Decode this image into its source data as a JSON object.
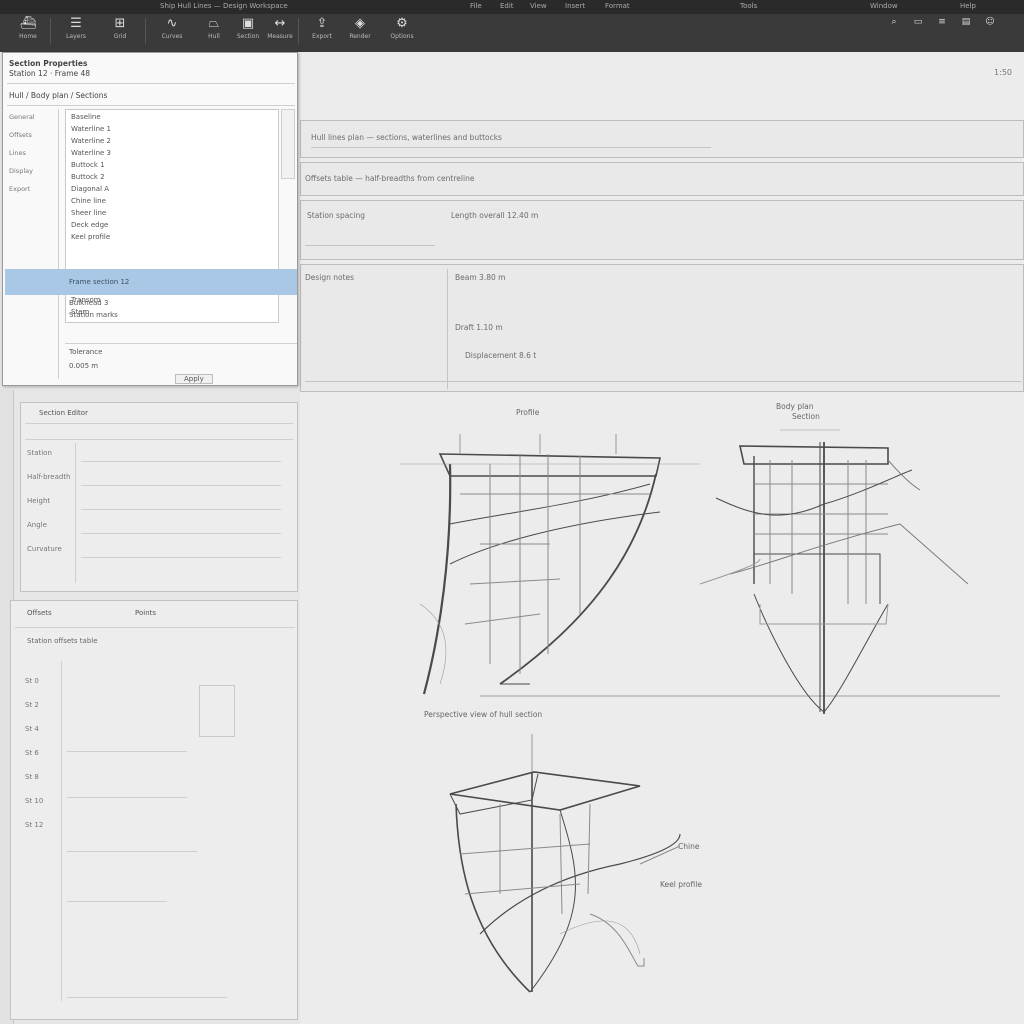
{
  "window": {
    "title": "Ship Hull Lines — Design Workspace",
    "menu": [
      "File",
      "Edit",
      "View",
      "Insert",
      "Format",
      "Tools",
      "Window",
      "Help"
    ]
  },
  "toolbar": {
    "buttons": [
      {
        "icon": "app-logo-icon",
        "glyph": "⛴",
        "label": "Home"
      },
      {
        "icon": "layers-icon",
        "glyph": "☰",
        "label": "Layers"
      },
      {
        "icon": "grid-icon",
        "glyph": "⊞",
        "label": "Grid"
      },
      {
        "icon": "curve-icon",
        "glyph": "∿",
        "label": "Curves"
      },
      {
        "icon": "hull-icon",
        "glyph": "⏢",
        "label": "Hull"
      },
      {
        "icon": "section-icon",
        "glyph": "▣",
        "label": "Section"
      },
      {
        "icon": "measure-icon",
        "glyph": "↔",
        "label": "Measure"
      },
      {
        "icon": "export-icon",
        "glyph": "⇪",
        "label": "Export"
      },
      {
        "icon": "render-icon",
        "glyph": "◈",
        "label": "Render"
      },
      {
        "icon": "settings-icon",
        "glyph": "⚙",
        "label": "Options"
      }
    ],
    "right_icons": [
      "search-icon",
      "window-icon",
      "list-icon",
      "panel-icon",
      "user-icon"
    ]
  },
  "dialog": {
    "title": "Section Properties",
    "subtitle": "Station 12  ·  Frame 48",
    "path_label": "Hull / Body plan / Sections",
    "side_items": [
      "General",
      "Offsets",
      "Lines",
      "Display",
      "Export"
    ],
    "list_items": [
      "Baseline",
      "Waterline 1",
      "Waterline 2",
      "Waterline 3",
      "Buttock 1",
      "Buttock 2",
      "Diagonal A",
      "Chine line",
      "Sheer line",
      "Deck edge",
      "Keel profile"
    ],
    "selected_item": "Frame section 12",
    "lower_items": [
      "Transom",
      "Stem",
      "Bulkhead 3",
      "Station marks"
    ],
    "footer_items": [
      "Tolerance",
      "0.005 m"
    ],
    "footer_button": "Apply"
  },
  "canvas": {
    "tag": "1:50",
    "rows": [
      "Hull lines plan — sections, waterlines and buttocks",
      "Offsets table — half-breadths from centreline",
      "Station spacing",
      "Length overall  12.40 m",
      "Design notes",
      "Beam  3.80 m",
      "Draft  1.10 m",
      "Displacement  8.6 t"
    ]
  },
  "panels": {
    "upper": {
      "title": "Section Editor",
      "rows": [
        "Station",
        "Half-breadth",
        "Height",
        "Angle",
        "Curvature"
      ]
    },
    "lower": {
      "title": "Offsets",
      "secondary": "Points",
      "header": "Station offsets table",
      "rows": [
        "St 0",
        "St 2",
        "St 4",
        "St 6",
        "St 8",
        "St 10",
        "St 12"
      ]
    }
  },
  "drawing": {
    "labels": {
      "view_a": "Profile",
      "view_b": "Body plan",
      "view_b_sub": "Section",
      "caption": "Perspective view of hull section",
      "callout_1": "Chine",
      "callout_2": "Keel profile"
    }
  },
  "colors": {
    "toolbar": "#3a3a3a",
    "selection": "#a9c8e6",
    "canvas": "#ececec",
    "line": "#4a4a4a"
  }
}
